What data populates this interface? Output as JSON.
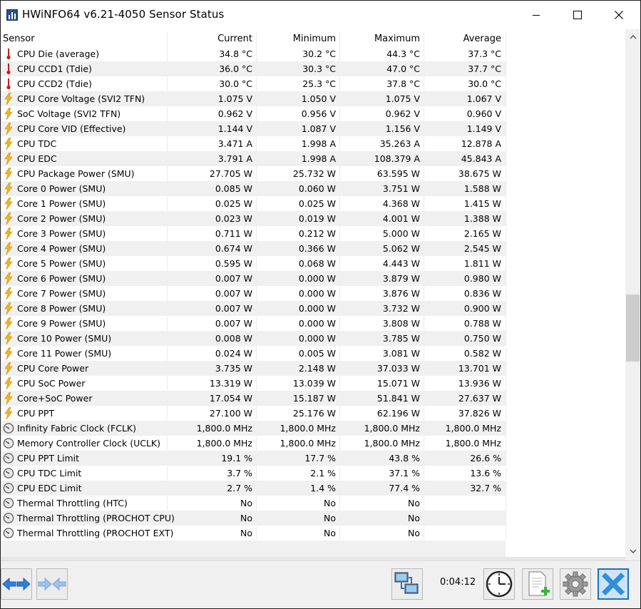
{
  "window": {
    "title": "HWiNFO64 v6.21-4050 Sensor Status"
  },
  "columns": {
    "sensor": "Sensor",
    "current": "Current",
    "minimum": "Minimum",
    "maximum": "Maximum",
    "average": "Average"
  },
  "rows": [
    {
      "icon": "thermometer-icon",
      "name": "CPU Die (average)",
      "current": "34.8 °C",
      "min": "30.2 °C",
      "max": "44.3 °C",
      "avg": "37.3 °C"
    },
    {
      "icon": "thermometer-icon",
      "name": "CPU CCD1 (Tdie)",
      "current": "36.0 °C",
      "min": "30.3 °C",
      "max": "47.0 °C",
      "avg": "37.7 °C"
    },
    {
      "icon": "thermometer-icon",
      "name": "CPU CCD2 (Tdie)",
      "current": "30.0 °C",
      "min": "25.3 °C",
      "max": "37.8 °C",
      "avg": "30.0 °C"
    },
    {
      "icon": "lightning-icon",
      "name": "CPU Core Voltage (SVI2 TFN)",
      "current": "1.075 V",
      "min": "1.050 V",
      "max": "1.075 V",
      "avg": "1.067 V"
    },
    {
      "icon": "lightning-icon",
      "name": "SoC Voltage (SVI2 TFN)",
      "current": "0.962 V",
      "min": "0.956 V",
      "max": "0.962 V",
      "avg": "0.960 V"
    },
    {
      "icon": "lightning-icon",
      "name": "CPU Core VID (Effective)",
      "current": "1.144 V",
      "min": "1.087 V",
      "max": "1.156 V",
      "avg": "1.149 V"
    },
    {
      "icon": "lightning-icon",
      "name": "CPU TDC",
      "current": "3.471 A",
      "min": "1.998 A",
      "max": "35.263 A",
      "avg": "12.878 A"
    },
    {
      "icon": "lightning-icon",
      "name": "CPU EDC",
      "current": "3.791 A",
      "min": "1.998 A",
      "max": "108.379 A",
      "avg": "45.843 A"
    },
    {
      "icon": "lightning-icon",
      "name": "CPU Package Power (SMU)",
      "current": "27.705 W",
      "min": "25.732 W",
      "max": "63.595 W",
      "avg": "38.675 W"
    },
    {
      "icon": "lightning-icon",
      "name": "Core 0 Power (SMU)",
      "current": "0.085 W",
      "min": "0.060 W",
      "max": "3.751 W",
      "avg": "1.588 W"
    },
    {
      "icon": "lightning-icon",
      "name": "Core 1 Power (SMU)",
      "current": "0.025 W",
      "min": "0.025 W",
      "max": "4.368 W",
      "avg": "1.415 W"
    },
    {
      "icon": "lightning-icon",
      "name": "Core 2 Power (SMU)",
      "current": "0.023 W",
      "min": "0.019 W",
      "max": "4.001 W",
      "avg": "1.388 W"
    },
    {
      "icon": "lightning-icon",
      "name": "Core 3 Power (SMU)",
      "current": "0.711 W",
      "min": "0.212 W",
      "max": "5.000 W",
      "avg": "2.165 W"
    },
    {
      "icon": "lightning-icon",
      "name": "Core 4 Power (SMU)",
      "current": "0.674 W",
      "min": "0.366 W",
      "max": "5.062 W",
      "avg": "2.545 W"
    },
    {
      "icon": "lightning-icon",
      "name": "Core 5 Power (SMU)",
      "current": "0.595 W",
      "min": "0.068 W",
      "max": "4.443 W",
      "avg": "1.811 W"
    },
    {
      "icon": "lightning-icon",
      "name": "Core 6 Power (SMU)",
      "current": "0.007 W",
      "min": "0.000 W",
      "max": "3.879 W",
      "avg": "0.980 W"
    },
    {
      "icon": "lightning-icon",
      "name": "Core 7 Power (SMU)",
      "current": "0.007 W",
      "min": "0.000 W",
      "max": "3.876 W",
      "avg": "0.836 W"
    },
    {
      "icon": "lightning-icon",
      "name": "Core 8 Power (SMU)",
      "current": "0.007 W",
      "min": "0.000 W",
      "max": "3.732 W",
      "avg": "0.900 W"
    },
    {
      "icon": "lightning-icon",
      "name": "Core 9 Power (SMU)",
      "current": "0.007 W",
      "min": "0.000 W",
      "max": "3.808 W",
      "avg": "0.788 W"
    },
    {
      "icon": "lightning-icon",
      "name": "Core 10 Power (SMU)",
      "current": "0.008 W",
      "min": "0.000 W",
      "max": "3.785 W",
      "avg": "0.750 W"
    },
    {
      "icon": "lightning-icon",
      "name": "Core 11 Power (SMU)",
      "current": "0.024 W",
      "min": "0.005 W",
      "max": "3.081 W",
      "avg": "0.582 W"
    },
    {
      "icon": "lightning-icon",
      "name": "CPU Core Power",
      "current": "3.735 W",
      "min": "2.148 W",
      "max": "37.033 W",
      "avg": "13.701 W"
    },
    {
      "icon": "lightning-icon",
      "name": "CPU SoC Power",
      "current": "13.319 W",
      "min": "13.039 W",
      "max": "15.071 W",
      "avg": "13.936 W"
    },
    {
      "icon": "lightning-icon",
      "name": "Core+SoC Power",
      "current": "17.054 W",
      "min": "15.187 W",
      "max": "51.841 W",
      "avg": "27.637 W"
    },
    {
      "icon": "lightning-icon",
      "name": "CPU PPT",
      "current": "27.100 W",
      "min": "25.176 W",
      "max": "62.196 W",
      "avg": "37.826 W"
    },
    {
      "icon": "gauge-icon",
      "name": "Infinity Fabric Clock (FCLK)",
      "current": "1,800.0 MHz",
      "min": "1,800.0 MHz",
      "max": "1,800.0 MHz",
      "avg": "1,800.0 MHz"
    },
    {
      "icon": "gauge-icon",
      "name": "Memory Controller Clock (UCLK)",
      "current": "1,800.0 MHz",
      "min": "1,800.0 MHz",
      "max": "1,800.0 MHz",
      "avg": "1,800.0 MHz"
    },
    {
      "icon": "gauge-icon",
      "name": "CPU PPT Limit",
      "current": "19.1 %",
      "min": "17.7 %",
      "max": "43.8 %",
      "avg": "26.6 %"
    },
    {
      "icon": "gauge-icon",
      "name": "CPU TDC Limit",
      "current": "3.7 %",
      "min": "2.1 %",
      "max": "37.1 %",
      "avg": "13.6 %"
    },
    {
      "icon": "gauge-icon",
      "name": "CPU EDC Limit",
      "current": "2.7 %",
      "min": "1.4 %",
      "max": "77.4 %",
      "avg": "32.7 %"
    },
    {
      "icon": "gauge-icon",
      "name": "Thermal Throttling (HTC)",
      "current": "No",
      "min": "No",
      "max": "No",
      "avg": ""
    },
    {
      "icon": "gauge-icon",
      "name": "Thermal Throttling (PROCHOT CPU)",
      "current": "No",
      "min": "No",
      "max": "No",
      "avg": ""
    },
    {
      "icon": "gauge-icon",
      "name": "Thermal Throttling (PROCHOT EXT)",
      "current": "No",
      "min": "No",
      "max": "No",
      "avg": ""
    }
  ],
  "toolbar": {
    "timer": "0:04:12"
  },
  "colors": {
    "close_button": "#2f8fd8",
    "arrow_blue": "#2f7fe0",
    "lightning": "#f2b61b",
    "thermo": "#c81e1e"
  }
}
